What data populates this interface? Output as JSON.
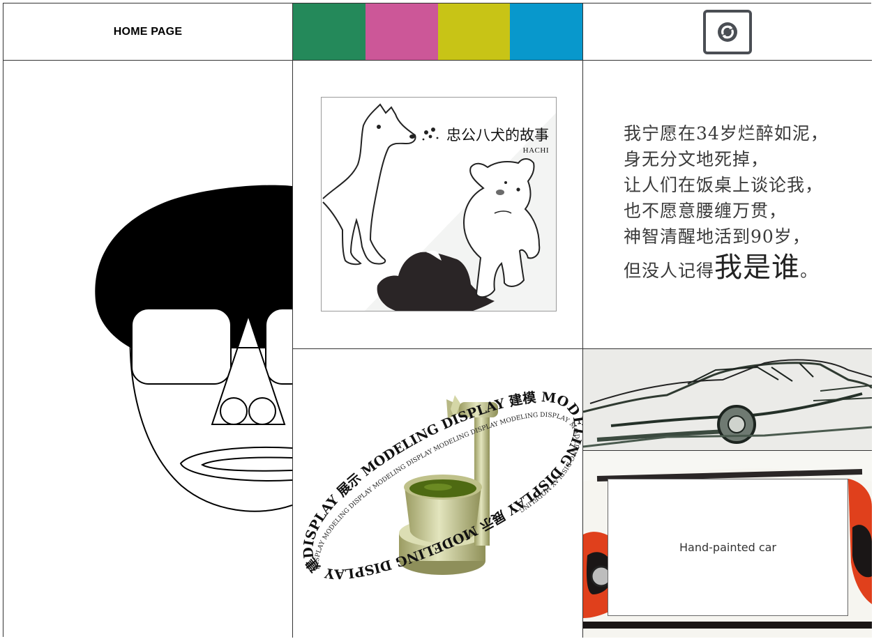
{
  "header": {
    "home_label": "HOME PAGE",
    "swatches": [
      {
        "name": "green",
        "color": "#24895a"
      },
      {
        "name": "pink",
        "color": "#cc5798"
      },
      {
        "name": "olive",
        "color": "#c8c416"
      },
      {
        "name": "blue",
        "color": "#0898cc"
      }
    ],
    "refresh_icon": "refresh-icon"
  },
  "hachi_poster": {
    "title": "忠公八犬的故事",
    "subtitle": "HACHI"
  },
  "poem": {
    "lines": [
      "我宁愿在34岁烂醉如泥，",
      "身无分文地死掉，",
      "让人们在饭桌上谈论我，",
      "也不愿意腰缠万贯，",
      "神智清醒地活到90岁，"
    ],
    "last_line_prefix": "但没人记得",
    "last_line_emphasis": "我是谁",
    "last_line_suffix": "。"
  },
  "model_display": {
    "ring_text_outer": "DISPLAY 展示 MODELING DISPLAY 建模 MODELING DISPLAY 展示 MODELING DISPLAY 建模 MODELING ",
    "ring_text_inner": "DISPLAY MODELING DISPLAY MODELING DISPLAY MODELING DISPLAY MODELING DISPLAY MODELING DISPLAY MODELING "
  },
  "red_car": {
    "caption": "Hand-painted car"
  },
  "colors": {
    "border": "#333333",
    "cup_olive": "#c7c99a",
    "matcha": "#4e6a12",
    "car_red": "#e0401c"
  }
}
